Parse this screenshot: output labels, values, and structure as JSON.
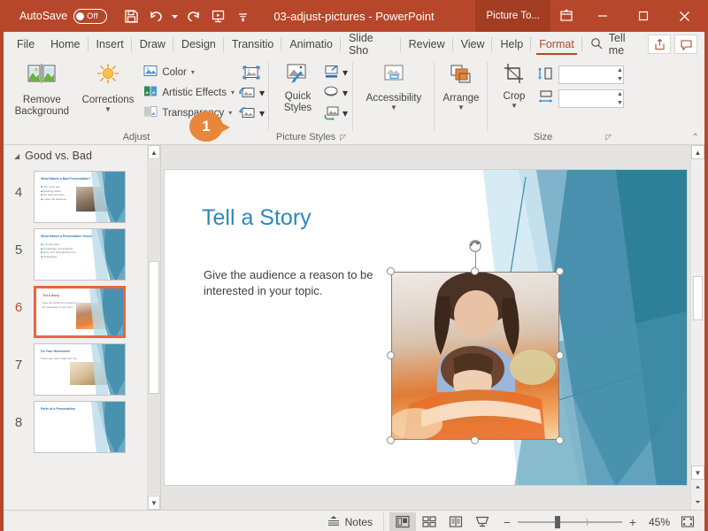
{
  "titlebar": {
    "autosave_label": "AutoSave",
    "autosave_state": "Off",
    "document_title": "03-adjust-pictures  -  PowerPoint",
    "context_tab": "Picture To...",
    "quick_access": [
      {
        "name": "save-icon",
        "label": "Save"
      },
      {
        "name": "undo-icon",
        "label": "Undo"
      },
      {
        "name": "redo-icon",
        "label": "Redo"
      },
      {
        "name": "start-presentation-icon",
        "label": "Start From Beginning"
      },
      {
        "name": "customize-qat-icon",
        "label": "Customize Quick Access Toolbar"
      }
    ],
    "window_buttons": {
      "minimize": "—",
      "maximize": "☐",
      "close": "✕"
    }
  },
  "menubar": {
    "items": [
      {
        "label": "File",
        "active": false
      },
      {
        "label": "Home",
        "active": false
      },
      {
        "label": "Insert",
        "active": false
      },
      {
        "label": "Draw",
        "active": false
      },
      {
        "label": "Design",
        "active": false
      },
      {
        "label": "Transitio",
        "active": false
      },
      {
        "label": "Animatio",
        "active": false
      },
      {
        "label": "Slide Sho",
        "active": false
      },
      {
        "label": "Review",
        "active": false
      },
      {
        "label": "View",
        "active": false
      },
      {
        "label": "Help",
        "active": false
      },
      {
        "label": "Format",
        "active": true
      }
    ],
    "tell_me": "Tell me",
    "share_label": "Share",
    "comments_label": "Comments"
  },
  "ribbon": {
    "groups": {
      "adjust": {
        "label": "Adjust",
        "remove_background": "Remove Background",
        "corrections": "Corrections",
        "color": "Color",
        "artistic_effects": "Artistic Effects",
        "transparency": "Transparency",
        "compress_pictures": "Compress Pictures",
        "change_picture": "Change Picture",
        "reset_picture": "Reset Picture"
      },
      "picture_styles": {
        "label": "Picture Styles",
        "quick_styles_line1": "Quick",
        "quick_styles_line2": "Styles",
        "picture_border": "Picture Border",
        "picture_effects": "Picture Effects",
        "picture_layout": "Picture Layout"
      },
      "accessibility": {
        "label": "Accessibility",
        "button": "Accessibility"
      },
      "arrange": {
        "label": "Arrange",
        "button": "Arrange"
      },
      "size": {
        "label": "Size",
        "crop": "Crop",
        "height_value": "",
        "width_value": "",
        "height_placeholder": "",
        "width_placeholder": ""
      }
    },
    "callout_number": "1",
    "collapse_ribbon": "⌃"
  },
  "thumbnails": {
    "section_title": "Good vs. Bad",
    "slides": [
      {
        "number": "4",
        "title": "What Makes a Bad Presentation?",
        "selected": false,
        "body": [
          "Too much text",
          "Reading slides",
          "No clear structure",
          "Loses the audience"
        ],
        "has_photo": true,
        "photo": "audience"
      },
      {
        "number": "5",
        "title": "What Makes a Presentation Good?",
        "selected": false,
        "body": [
          "A strong start",
          "Knowledge and authority",
          "Story and arrangement information",
          "Networking"
        ],
        "has_photo": false,
        "photo": ""
      },
      {
        "number": "6",
        "title": "Tell a Story",
        "selected": true,
        "body": [
          "Give the audience a reason to be interested in your topic."
        ],
        "has_photo": true,
        "photo": "reading"
      },
      {
        "number": "7",
        "title": "Do Your Homework",
        "selected": false,
        "body": [
          "Know your topic inside and out"
        ],
        "has_photo": true,
        "photo": "books"
      },
      {
        "number": "8",
        "title": "Parts of a Presentation",
        "selected": false,
        "body": [],
        "has_photo": false,
        "photo": ""
      }
    ]
  },
  "slide": {
    "title": "Tell a Story",
    "body": "Give the audience a reason to be interested in your topic.",
    "selected_object": "picture",
    "handle_count": 8,
    "rotation_handle": true
  },
  "statusbar": {
    "notes_label": "Notes",
    "views": [
      {
        "name": "normal-view-button",
        "active": true
      },
      {
        "name": "slide-sorter-view-button",
        "active": false
      },
      {
        "name": "reading-view-button",
        "active": false
      },
      {
        "name": "slide-show-button",
        "active": false
      }
    ],
    "zoom_out": "−",
    "zoom_in": "+",
    "zoom_level": "45%",
    "fit_slide_label": "Fit slide to current window"
  },
  "colors": {
    "brand_red": "#b7472a",
    "context_tab_red": "#a33d22",
    "callout_orange": "#e8863c",
    "slide_title_blue": "#2e87bd",
    "selection_orange": "#e8663d"
  }
}
